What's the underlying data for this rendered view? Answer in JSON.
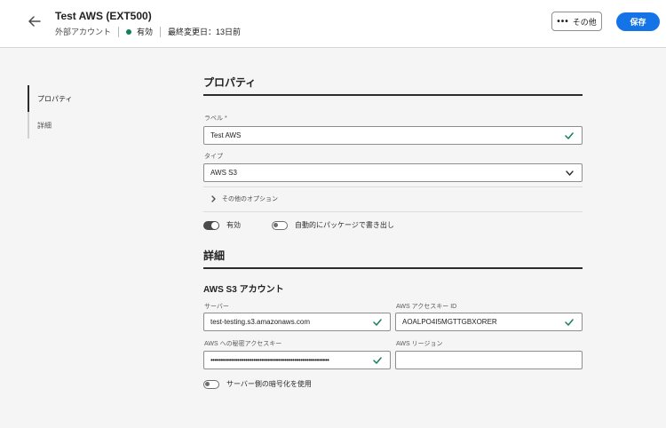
{
  "header": {
    "title": "Test AWS (EXT500)",
    "type": "外部アカウント",
    "status": "有効",
    "last_modified_label": "最終変更日：",
    "last_modified_value": "13日前",
    "more_label": "その他",
    "save_label": "保存"
  },
  "sidenav": {
    "items": [
      {
        "label": "プロパティ",
        "active": true
      },
      {
        "label": "詳細",
        "active": false
      }
    ]
  },
  "properties": {
    "section_title": "プロパティ",
    "label_field": {
      "label": "ラベル",
      "required_mark": "*",
      "value": "Test AWS"
    },
    "type_field": {
      "label": "タイプ",
      "value": "AWS S3"
    },
    "more_options": "その他のオプション",
    "enabled_toggle": {
      "label": "有効",
      "on": true
    },
    "auto_export_toggle": {
      "label": "自動的にパッケージで書き出し",
      "on": false
    }
  },
  "details": {
    "section_title": "詳細",
    "subsection_title": "AWS S3 アカウント",
    "server": {
      "label": "サーバー",
      "value": "test-testing.s3.amazonaws.com"
    },
    "access_key_id": {
      "label": "AWS アクセスキー ID",
      "value": "AOALPO4I5MGTTGBXORER"
    },
    "secret_key": {
      "label": "AWS への秘密アクセスキー",
      "value": "••••••••••••••••••••••••••••••••••••••••••••••••••••••••••"
    },
    "region": {
      "label": "AWS リージョン",
      "value": ""
    },
    "encryption_toggle": {
      "label": "サーバー側の暗号化を使用",
      "on": false
    }
  },
  "colors": {
    "accent": "#1473e6",
    "status_green": "#12805c",
    "check_green": "#12805c"
  },
  "icons": {
    "back": "arrow-left-icon",
    "more": "more-dots-icon",
    "check": "checkmark-icon",
    "chevron_down": "chevron-down-icon",
    "chevron_right": "chevron-right-icon"
  }
}
